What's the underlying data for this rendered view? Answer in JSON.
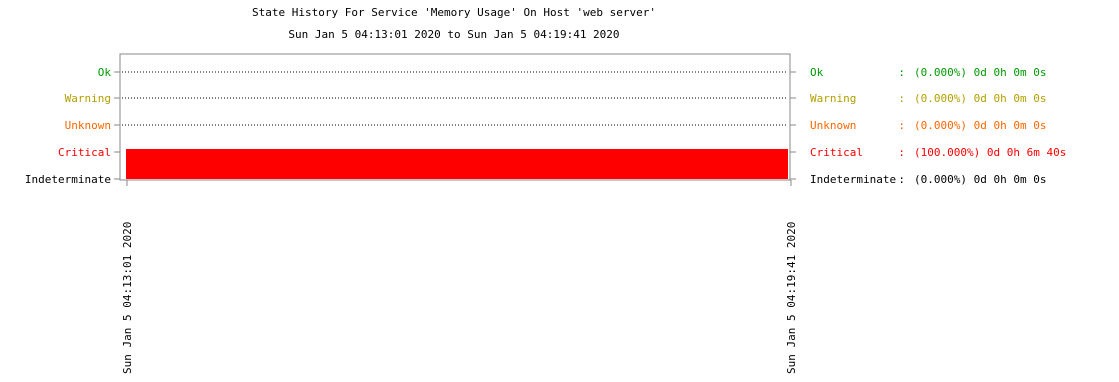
{
  "chart_data": {
    "type": "timeline",
    "title": "State History For Service 'Memory Usage' On Host 'web server'",
    "subtitle": "Sun Jan  5 04:13:01 2020 to Sun Jan  5 04:19:41 2020",
    "states": [
      {
        "name": "Ok",
        "color": "#009900",
        "percent": "(0.000%)",
        "duration": "0d 0h 0m 0s"
      },
      {
        "name": "Warning",
        "color": "#b3a000",
        "percent": "(0.000%)",
        "duration": "0d 0h 0m 0s"
      },
      {
        "name": "Unknown",
        "color": "#ff6600",
        "percent": "(0.000%)",
        "duration": "0d 0h 0m 0s"
      },
      {
        "name": "Critical",
        "color": "#ff0000",
        "percent": "(100.000%)",
        "duration": "0d 0h 6m 40s"
      },
      {
        "name": "Indeterminate",
        "color": "#000000",
        "percent": "(0.000%)",
        "duration": "0d 0h 0m 0s"
      }
    ],
    "bars": [
      {
        "state": "Critical",
        "start": "2020-01-05 04:13:01",
        "end": "2020-01-05 04:19:41",
        "color": "#ff0000"
      }
    ],
    "x_range": [
      "2020-01-05 04:13:01",
      "2020-01-05 04:19:41"
    ],
    "x_tick_labels": [
      "Sun Jan  5 04:13:01 2020",
      "Sun Jan  5 04:19:41 2020"
    ]
  }
}
